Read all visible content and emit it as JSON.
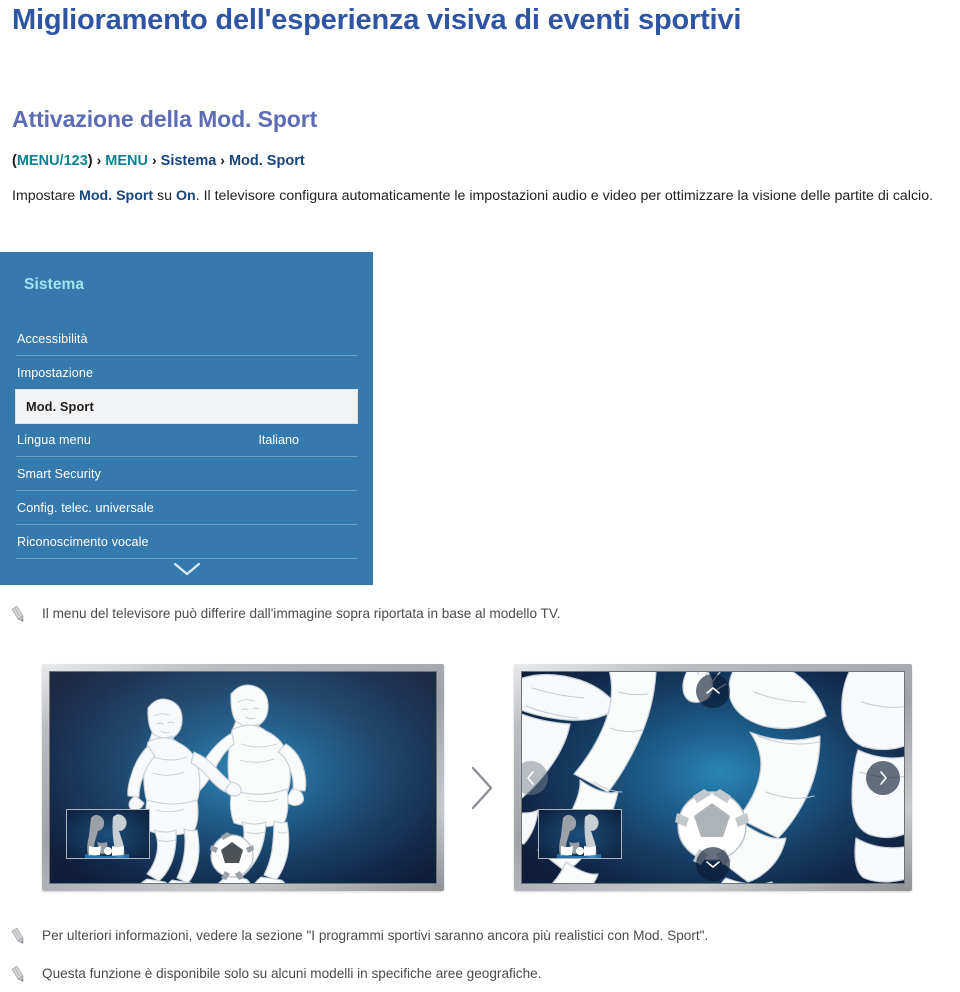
{
  "page": {
    "title": "Miglioramento dell'esperienza visiva di eventi sportivi",
    "section_title": "Attivazione della Mod. Sport"
  },
  "breadcrumb": {
    "open_paren": "(",
    "item1": "MENU/123",
    "close_paren": ")",
    "sep": "›",
    "item2": "MENU",
    "item3": "Sistema",
    "item4": "Mod. Sport"
  },
  "intro": {
    "part1": "Impostare ",
    "link1": "Mod. Sport",
    "part2": " su ",
    "link2": "On",
    "part3": ". Il televisore configura automaticamente le impostazioni audio e video per ottimizzare la visione delle partite di calcio."
  },
  "menu_panel": {
    "header": "Sistema",
    "scroll_down_icon": "chevron-down-icon",
    "items": [
      {
        "label": "Accessibilità",
        "value": "",
        "selected": false
      },
      {
        "label": "Impostazione",
        "value": "",
        "selected": false
      },
      {
        "label": "Mod. Sport",
        "value": "",
        "selected": true
      },
      {
        "label": "Lingua menu",
        "value": "Italiano",
        "selected": false
      },
      {
        "label": "Smart Security",
        "value": "",
        "selected": false
      },
      {
        "label": "Config. telec. universale",
        "value": "",
        "selected": false
      },
      {
        "label": "Riconoscimento vocale",
        "value": "",
        "selected": false
      }
    ]
  },
  "notes": [
    {
      "icon": "pencil-note-icon",
      "text": "Il menu del televisore può differire dall'immagine sopra riportata in base al modello TV."
    },
    {
      "icon": "pencil-note-icon",
      "text": "Per ulteriori informazioni, vedere la sezione \"I programmi sportivi saranno ancora più realistici con Mod. Sport\"."
    },
    {
      "icon": "pencil-note-icon",
      "text": "Questa funzione è disponibile solo su alcuni modelli in specifiche aree geografiche."
    }
  ],
  "figure": {
    "left_tv": {
      "name": "tv-normal-view",
      "pip_name": "picture-in-picture-thumbnail"
    },
    "transition_icon": "chevron-right-icon",
    "right_tv": {
      "name": "tv-zoomed-view",
      "pip_name": "picture-in-picture-thumbnail",
      "nav_up_icon": "chevron-up-icon",
      "nav_down_icon": "chevron-down-icon",
      "nav_left_icon": "chevron-left-icon",
      "nav_right_icon": "chevron-right-icon"
    }
  },
  "colors": {
    "title_blue": "#2e55a3",
    "section_purple": "#5d6cb4",
    "breadcrumb_teal": "#0d8193",
    "breadcrumb_navy": "#15447e",
    "panel_blue": "#3679ad",
    "panel_header_cyan": "#9fe5f0",
    "selected_row_bg": "#f1f3f5",
    "note_gray": "#4b4b4b"
  }
}
